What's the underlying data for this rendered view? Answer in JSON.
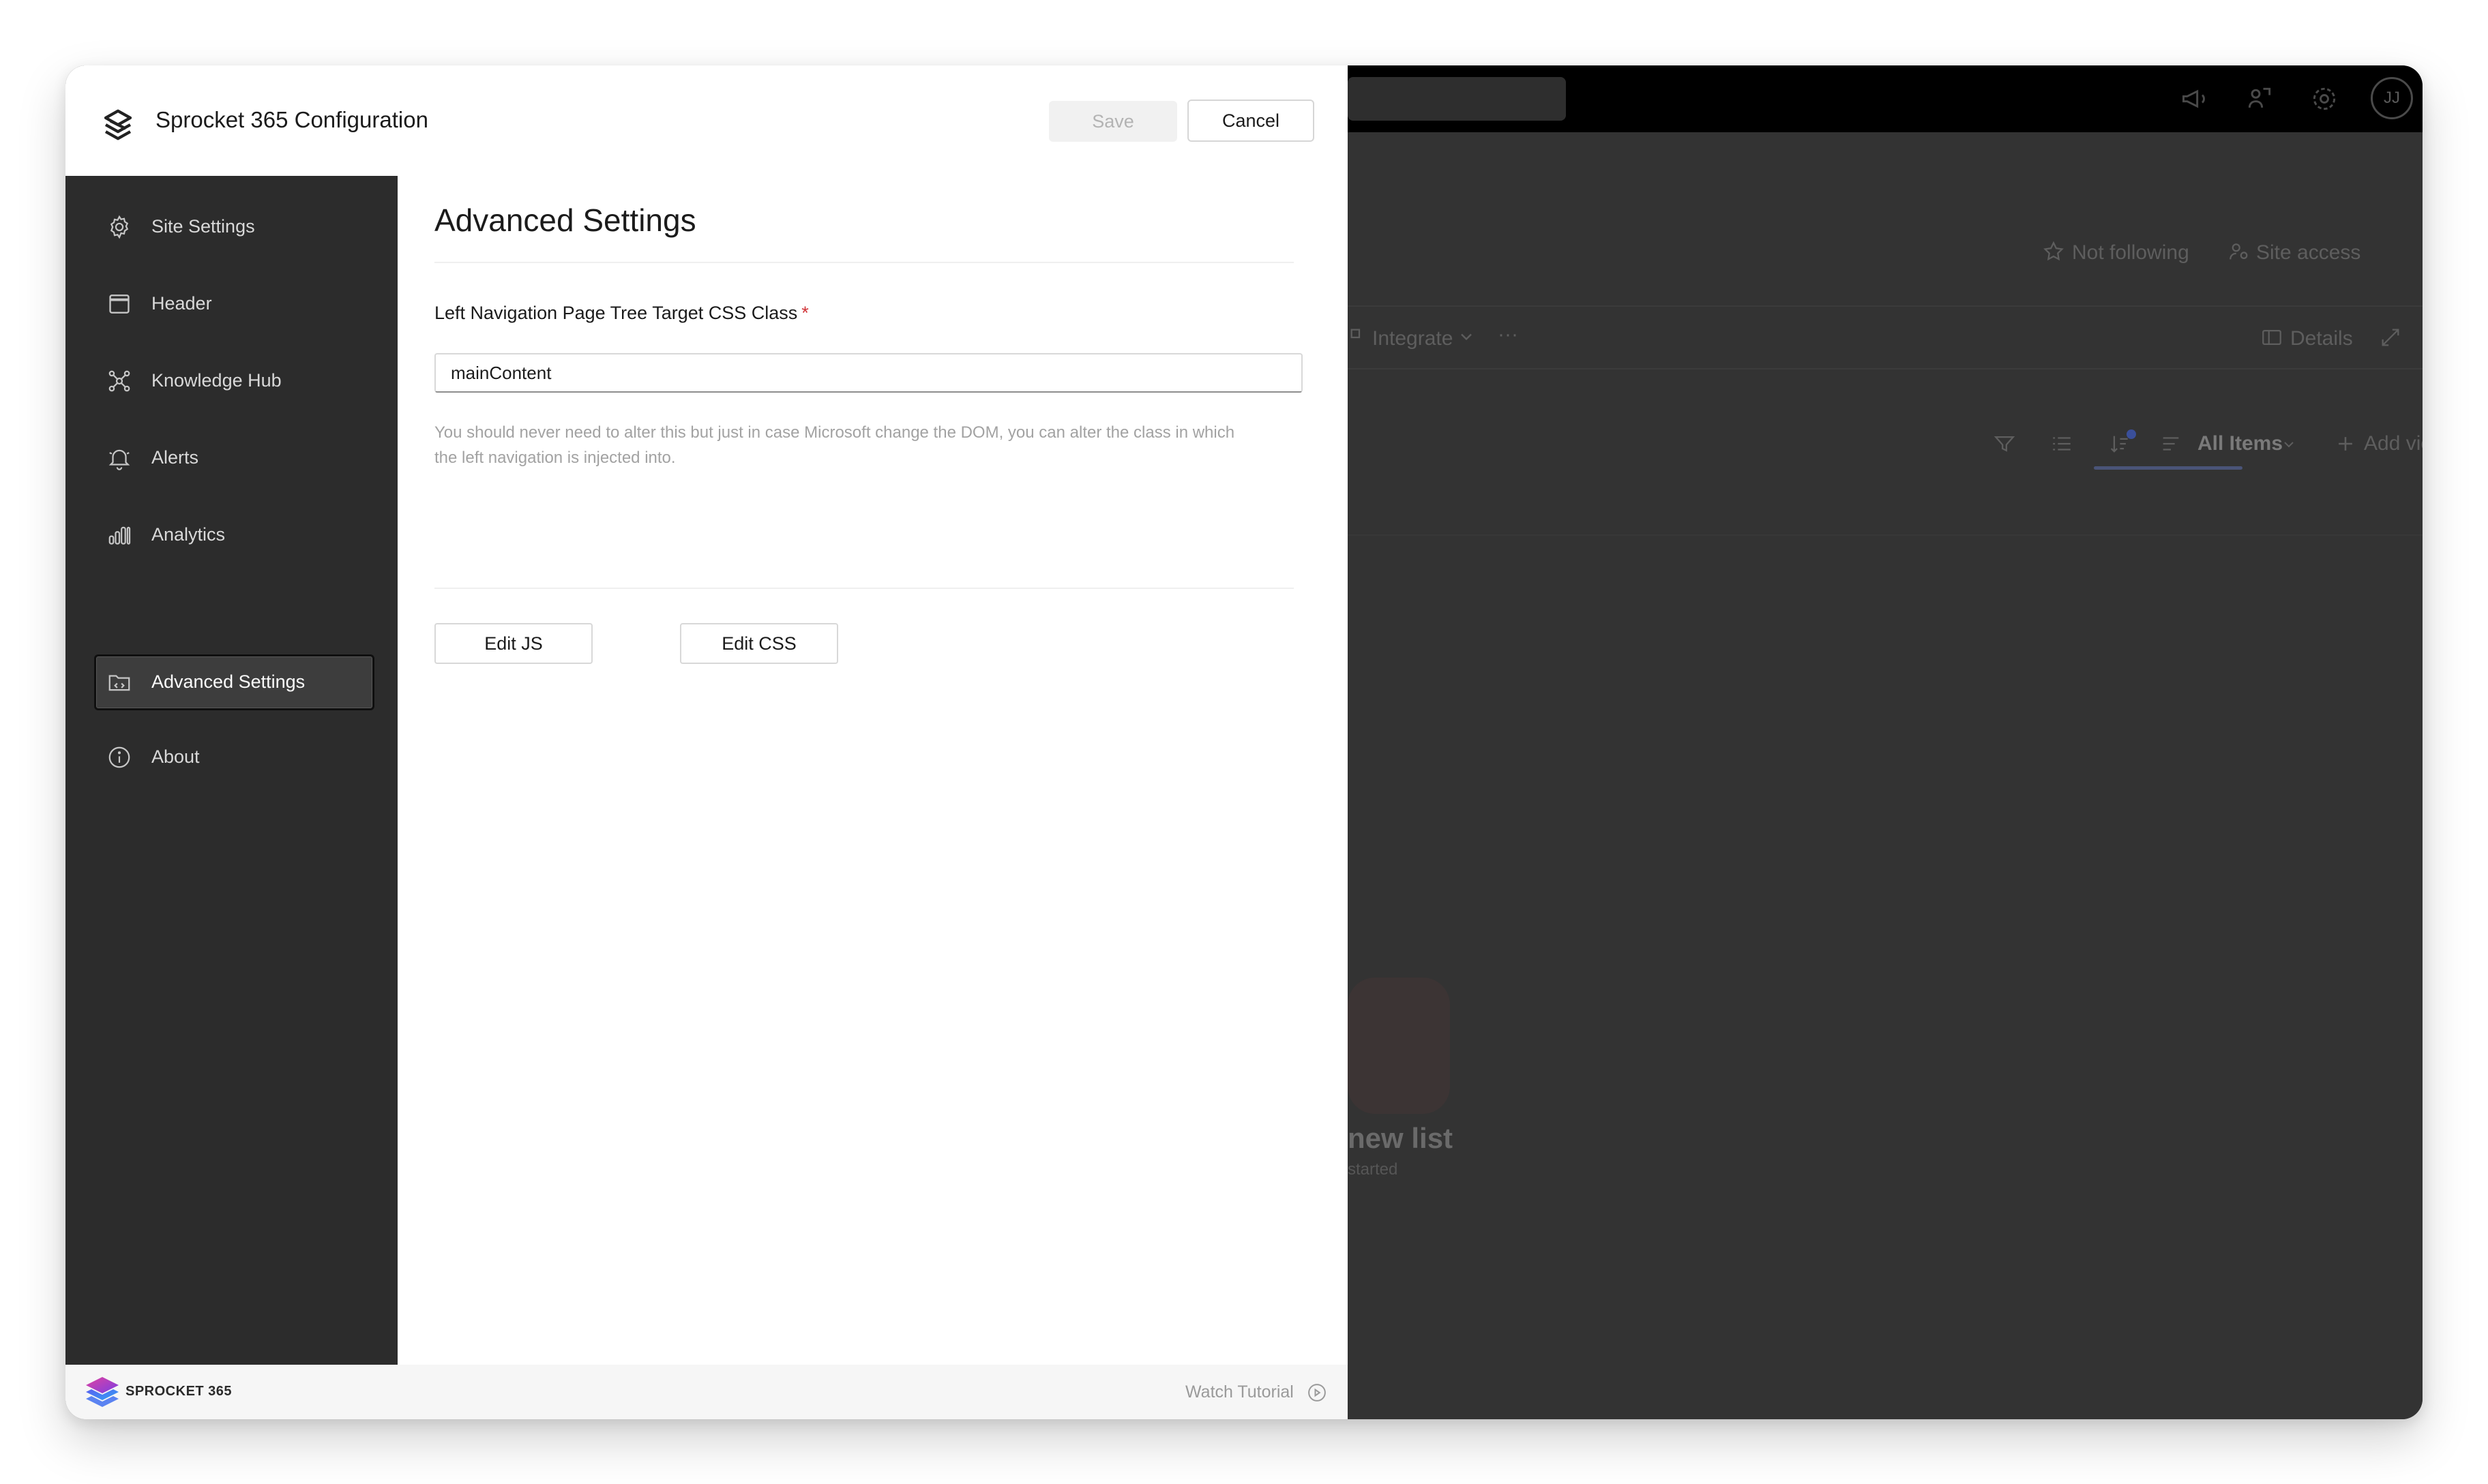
{
  "panel": {
    "title": "Sprocket 365 Configuration",
    "save_label": "Save",
    "cancel_label": "Cancel"
  },
  "sidebar": {
    "items": [
      {
        "label": "Site Settings",
        "icon": "gear-icon"
      },
      {
        "label": "Header",
        "icon": "header-window-icon"
      },
      {
        "label": "Knowledge Hub",
        "icon": "network-icon"
      },
      {
        "label": "Alerts",
        "icon": "bell-icon"
      },
      {
        "label": "Analytics",
        "icon": "bar-chart-icon"
      },
      {
        "label": "Advanced Settings",
        "icon": "folder-code-icon",
        "active": true
      },
      {
        "label": "About",
        "icon": "info-icon"
      }
    ]
  },
  "content": {
    "title": "Advanced Settings",
    "field_label": "Left Navigation Page Tree Target CSS Class",
    "required_mark": "*",
    "field_value": "mainContent",
    "help_line1": "You should never need to alter this but just in case Microsoft change the DOM, you can alter the class in which",
    "help_line2": "the left navigation is injected into.",
    "edit_js_label": "Edit JS",
    "edit_css_label": "Edit CSS"
  },
  "footer": {
    "brand": "SPROCKET 365",
    "watch_tutorial": "Watch Tutorial"
  },
  "background": {
    "avatar_initials": "JJ",
    "not_following": "Not following",
    "site_access": "Site access",
    "integrate": "Integrate",
    "more": "···",
    "details": "Details",
    "all_items": "All Items",
    "add_view": "Add view",
    "empty_title": "new list",
    "empty_sub": "started"
  },
  "colors": {
    "sidebar_bg": "#2c2c2c",
    "required": "#d13438",
    "active_view_underline": "#4a5478"
  }
}
